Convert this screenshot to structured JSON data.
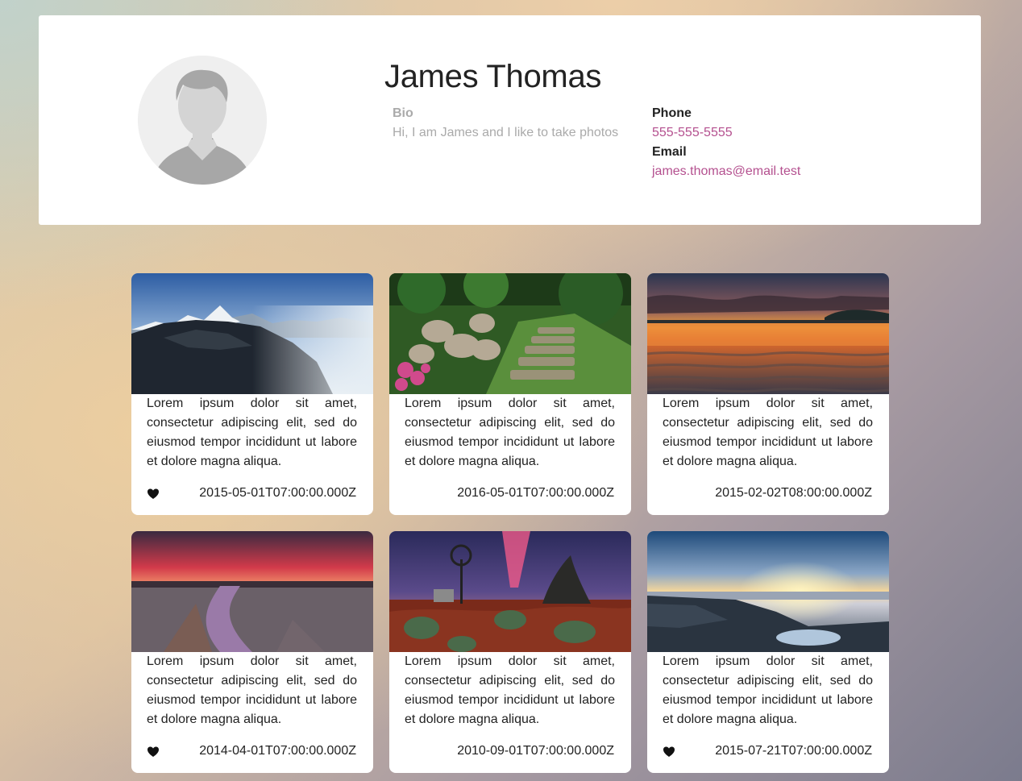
{
  "profile": {
    "name": "James Thomas",
    "bio_label": "Bio",
    "bio": "Hi, I am James and I like to take photos",
    "phone_label": "Phone",
    "phone": "555-555-5555",
    "email_label": "Email",
    "email": "james.thomas@email.test",
    "avatar_icon": "user-silhouette-icon"
  },
  "colors": {
    "link": "#b4508f",
    "muted": "#aaaaaa",
    "text": "#222222"
  },
  "photos": [
    {
      "scene": "mountains",
      "text": "Lorem ipsum dolor sit amet, consectetur adipiscing elit, sed do eiusmod tempor incididunt ut labore et dolore magna aliqua.",
      "date": "2015-05-01T07:00:00.000Z",
      "liked": true
    },
    {
      "scene": "garden-steps",
      "text": "Lorem ipsum dolor sit amet, consectetur adipiscing elit, sed do eiusmod tempor incididunt ut labore et dolore magna aliqua.",
      "date": "2016-05-01T07:00:00.000Z",
      "liked": false
    },
    {
      "scene": "beach-sunset",
      "text": "Lorem ipsum dolor sit amet, consectetur adipiscing elit, sed do eiusmod tempor incididunt ut labore et dolore magna aliqua.",
      "date": "2015-02-02T08:00:00.000Z",
      "liked": false
    },
    {
      "scene": "creek-sunset",
      "text": "Lorem ipsum dolor sit amet, consectetur adipiscing elit, sed do eiusmod tempor incididunt ut labore et dolore magna aliqua.",
      "date": "2014-04-01T07:00:00.000Z",
      "liked": true
    },
    {
      "scene": "windmill",
      "text": "Lorem ipsum dolor sit amet, consectetur adipiscing elit, sed do eiusmod tempor incididunt ut labore et dolore magna aliqua.",
      "date": "2010-09-01T07:00:00.000Z",
      "liked": false
    },
    {
      "scene": "rocky-shore",
      "text": "Lorem ipsum dolor sit amet, consectetur adipiscing elit, sed do eiusmod tempor incididunt ut labore et dolore magna aliqua.",
      "date": "2015-07-21T07:00:00.000Z",
      "liked": true
    }
  ]
}
